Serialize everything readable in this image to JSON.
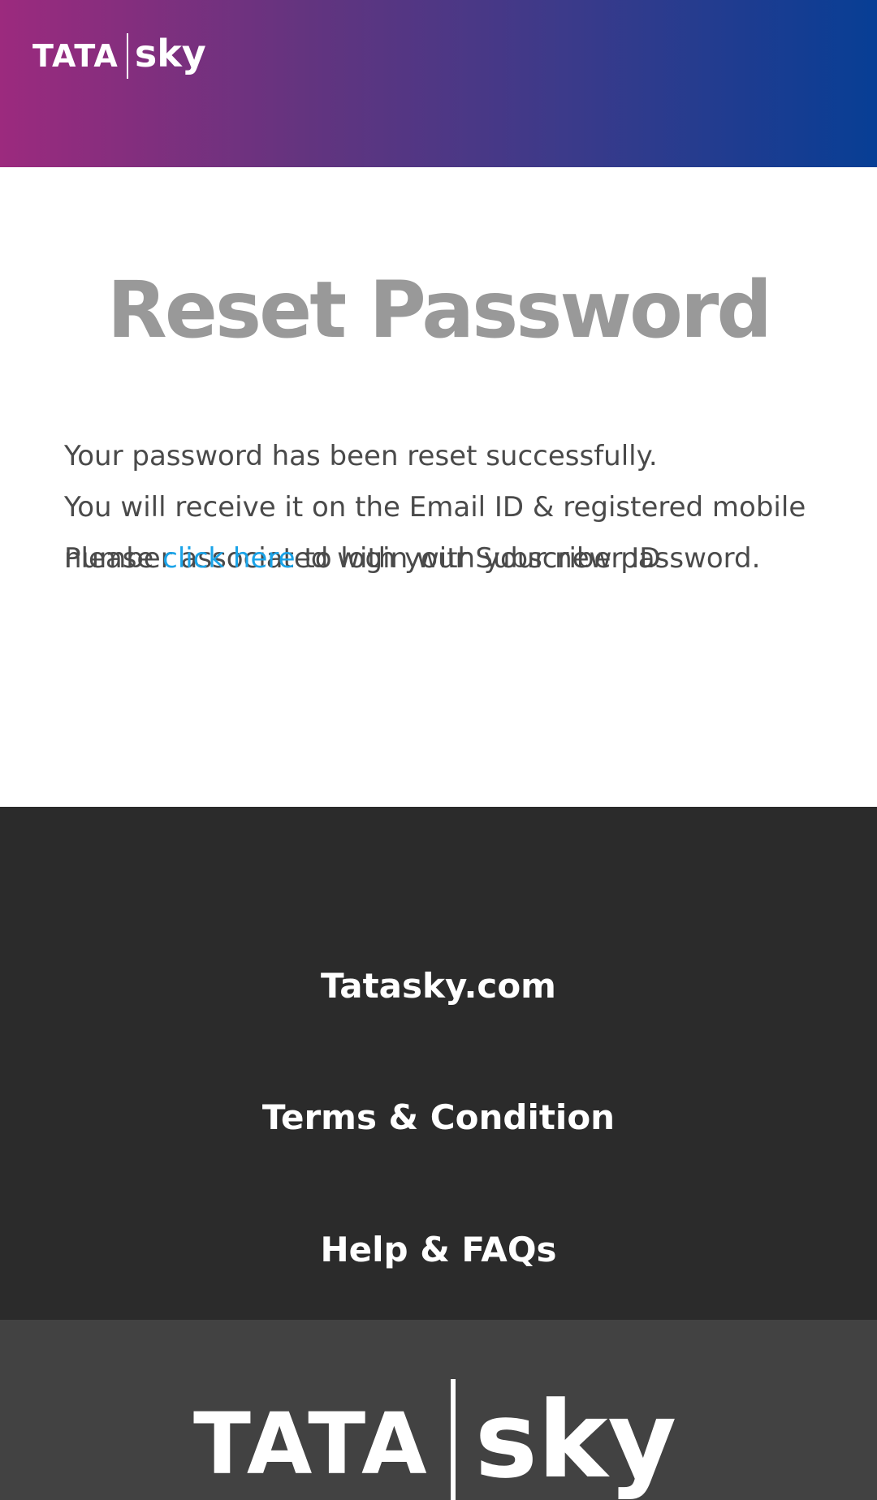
{
  "header": {
    "logo": {
      "left_text": "TATA",
      "right_text": "sky"
    }
  },
  "main": {
    "title": "Reset Password",
    "line1": "Your password has been reset successfully.",
    "line2": "You will receive it on the Email ID & registered mobile number associated with your Subscriber ID",
    "cta_prefix": "Please ",
    "cta_link": "click here",
    "cta_suffix": " to login with your new password."
  },
  "footer": {
    "links": [
      "Tatasky.com",
      "Terms & Condition",
      "Help & FAQs"
    ],
    "logo": {
      "left_text": "TATA",
      "right_text": "sky"
    }
  },
  "colors": {
    "header_gradient_start": "#9c2a7e",
    "header_gradient_end": "#073e95",
    "title": "#999999",
    "body_text": "#4a4a4a",
    "link": "#1aa3e8",
    "footer_bg": "#2b2b2b",
    "footer_logo_bg": "#424242"
  }
}
